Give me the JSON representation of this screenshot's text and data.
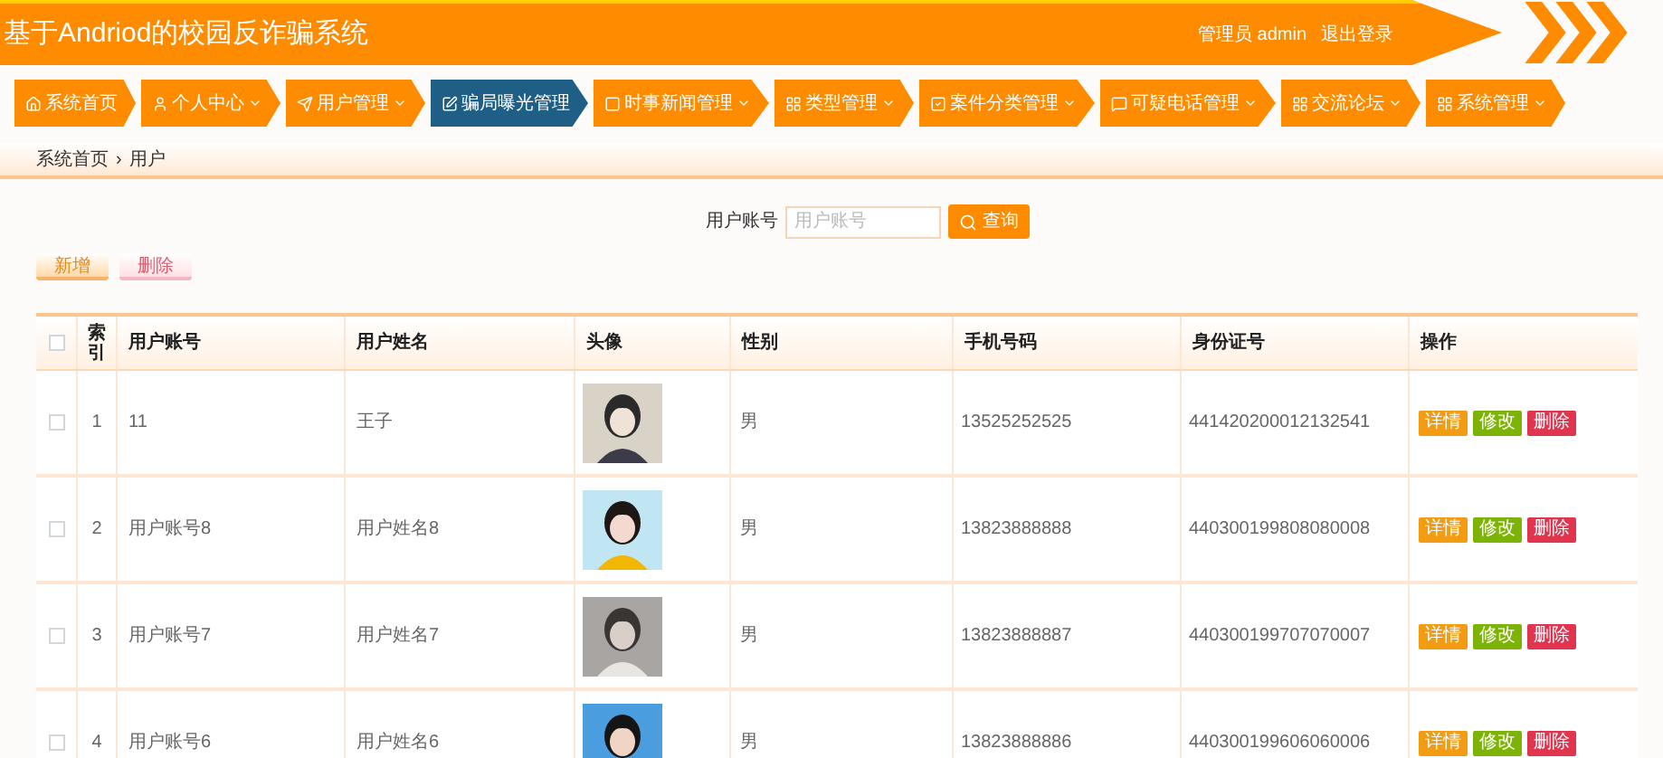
{
  "header": {
    "title": "基于Andriod的校园反诈骗系统",
    "user_label": "管理员 admin",
    "logout": "退出登录"
  },
  "nav": [
    {
      "label": "系统首页",
      "dropdown": false,
      "selected": false
    },
    {
      "label": "个人中心",
      "dropdown": true,
      "selected": false
    },
    {
      "label": "用户管理",
      "dropdown": true,
      "selected": false
    },
    {
      "label": "骗局曝光管理",
      "dropdown": false,
      "selected": true
    },
    {
      "label": "时事新闻管理",
      "dropdown": true,
      "selected": false
    },
    {
      "label": "类型管理",
      "dropdown": true,
      "selected": false
    },
    {
      "label": "案件分类管理",
      "dropdown": true,
      "selected": false
    },
    {
      "label": "可疑电话管理",
      "dropdown": true,
      "selected": false
    },
    {
      "label": "交流论坛",
      "dropdown": true,
      "selected": false
    },
    {
      "label": "系统管理",
      "dropdown": true,
      "selected": false
    }
  ],
  "breadcrumb": [
    "系统首页",
    "›",
    "用户"
  ],
  "search": {
    "label": "用户账号",
    "placeholder": "用户账号",
    "button": "查询"
  },
  "actions": [
    "新增",
    "删除"
  ],
  "table": {
    "header_checked": false,
    "columns": [
      "索引",
      "用户账号",
      "用户姓名",
      "头像",
      "性别",
      "手机号码",
      "身份证号",
      "操作"
    ],
    "rows": [
      {
        "checked": false,
        "index": "1",
        "account": "11",
        "name": "王子",
        "photo": {
          "kind": "picture"
        },
        "gender": "男",
        "phone": "13525252525",
        "id_number": "441420200012132541",
        "buttons": [
          "详情",
          "修改",
          "删除"
        ]
      },
      {
        "checked": false,
        "index": "2",
        "account": "用户账号8",
        "name": "用户姓名8",
        "photo": {
          "kind": "picture"
        },
        "gender": "男",
        "phone": "13823888888",
        "id_number": "440300199808080008",
        "buttons": [
          "详情",
          "修改",
          "删除"
        ]
      },
      {
        "checked": false,
        "index": "3",
        "account": "用户账号7",
        "name": "用户姓名7",
        "photo": {
          "kind": "picture"
        },
        "gender": "男",
        "phone": "13823888887",
        "id_number": "440300199707070007",
        "buttons": [
          "详情",
          "修改",
          "删除"
        ]
      },
      {
        "checked": false,
        "index": "4",
        "account": "用户账号6",
        "name": "用户姓名6",
        "photo": {
          "kind": "picture"
        },
        "gender": "男",
        "phone": "13823888886",
        "id_number": "440300199606060006",
        "buttons": [
          "详情",
          "修改",
          "删除"
        ]
      }
    ]
  }
}
